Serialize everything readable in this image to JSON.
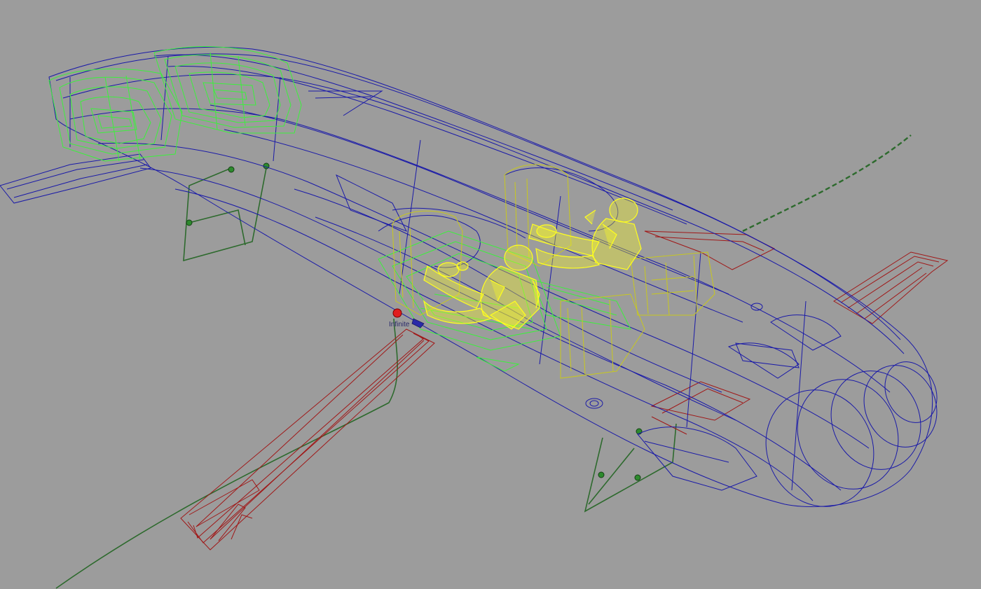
{
  "viewport": {
    "background": "#9c9c9c",
    "label": "Infinite"
  },
  "colors": {
    "body_wire": "#1a1aa8",
    "seat_wire": "#3cf03c",
    "manikin_wire": "#ffff1e",
    "frame_wire": "#b8b81e",
    "wing_wire": "#a01818",
    "guide_wire": "#2d6a2d",
    "marker": "#e01e1e"
  },
  "objects": [
    {
      "name": "fuselage-body",
      "icon": "wireframe"
    },
    {
      "name": "front-seat-group",
      "icon": "wireframe"
    },
    {
      "name": "driver-manikin",
      "icon": "wireframe"
    },
    {
      "name": "passenger-manikin",
      "icon": "wireframe"
    },
    {
      "name": "wing-left",
      "icon": "wireframe"
    },
    {
      "name": "wing-right",
      "icon": "wireframe"
    },
    {
      "name": "guide-curve",
      "icon": "polyline"
    }
  ]
}
